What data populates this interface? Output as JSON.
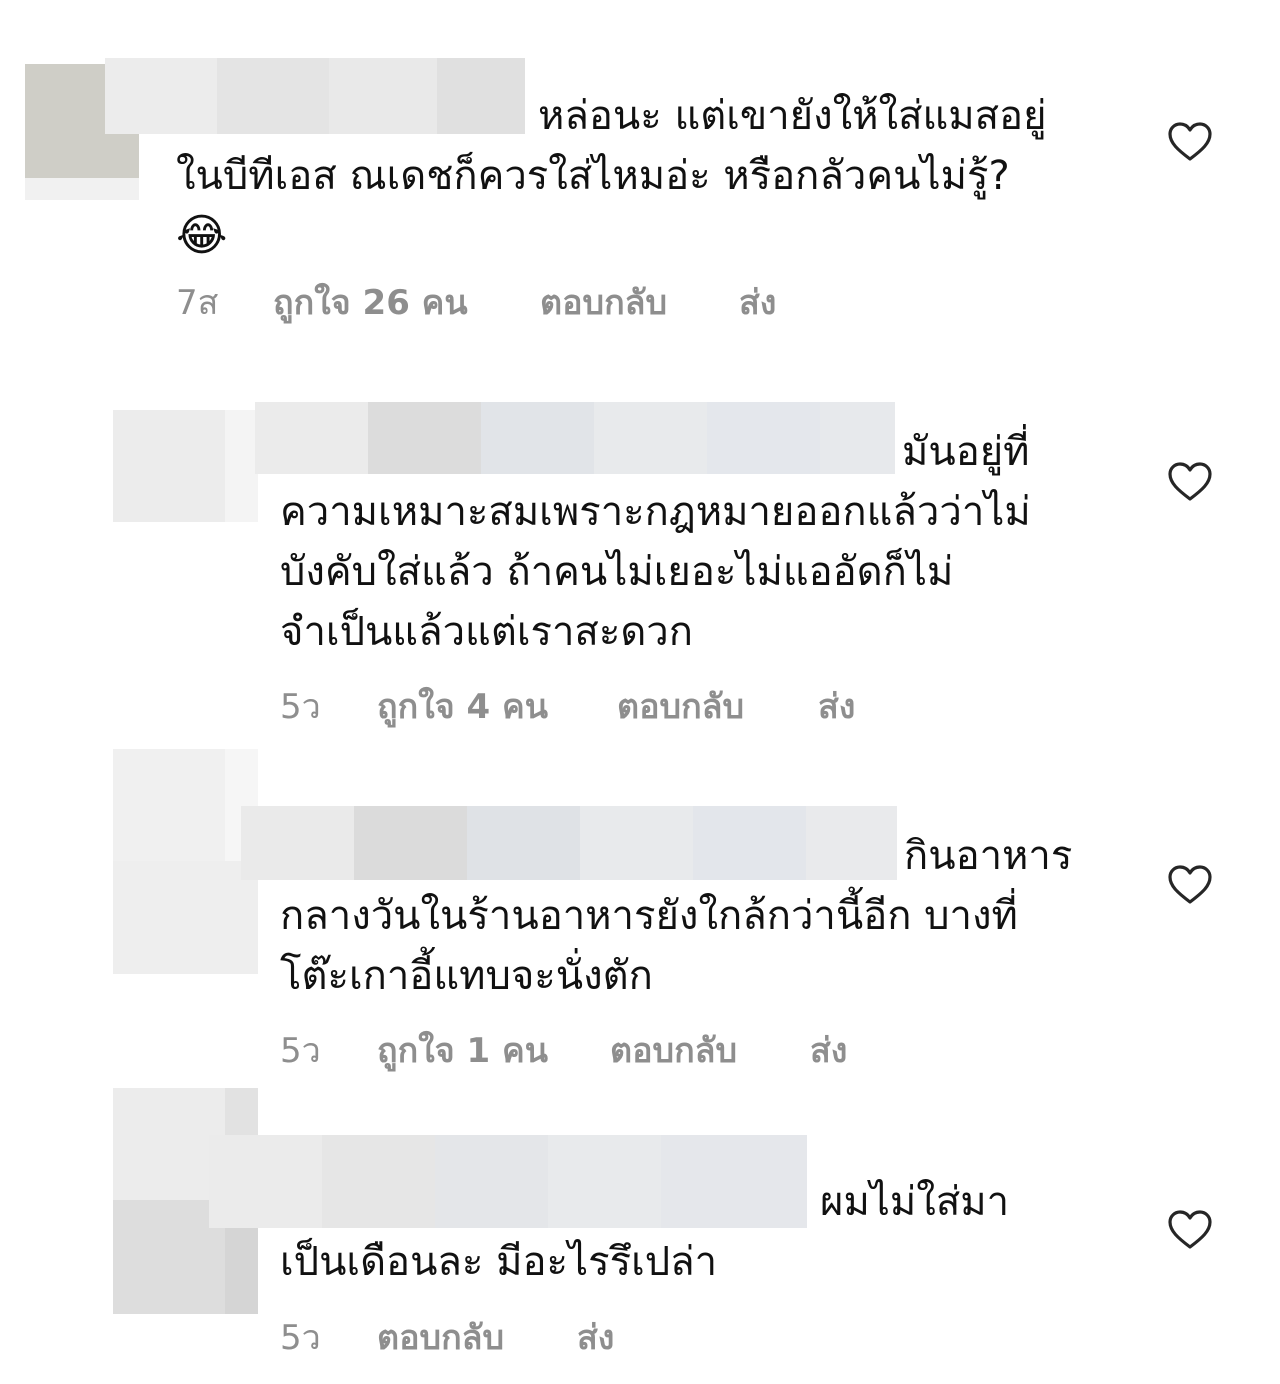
{
  "comments": [
    {
      "text_lines": [
        "หล่อนะ แต่เขายังให้ใส่แมสอยู่",
        "ในบีทีเอส ณเดชก็ควรใส่ไหมอ่ะ หรือกลัวคนไม่รู้?"
      ],
      "emoji": "😂",
      "time": "7ส",
      "likes": "ถูกใจ 26 คน",
      "reply": "ตอบกลับ",
      "send": "ส่ง"
    },
    {
      "text_lines": [
        "มันอยู่ที่",
        "ความเหมาะสมเพราะกฎหมายออกแล้วว่าไม่",
        "บังคับใส่แล้ว ถ้าคนไม่เยอะไม่แออัดก็ไม่",
        "จำเป็นแล้วแต่เราสะดวก"
      ],
      "time": "5ว",
      "likes": "ถูกใจ 4 คน",
      "reply": "ตอบกลับ",
      "send": "ส่ง"
    },
    {
      "text_lines": [
        "กินอาหาร",
        "กลางวันในร้านอาหารยังใกล้กว่านี้อีก บางที่",
        "โต๊ะเกาอี้แทบจะนั่งตัก"
      ],
      "time": "5ว",
      "likes": "ถูกใจ 1 คน",
      "reply": "ตอบกลับ",
      "send": "ส่ง"
    },
    {
      "text_lines": [
        "ผมไม่ใส่มา",
        "เป็นเดือนละ มีอะไรรึเปล่า"
      ],
      "time": "5ว",
      "reply": "ตอบกลับ",
      "send": "ส่ง"
    }
  ],
  "colors": {
    "text": "#111111",
    "meta": "#8e8e8e",
    "blur_light": "#e6e6e6",
    "blur_mid": "#dadada",
    "blur_blue": "#e1e5ea"
  },
  "icons": {
    "like": "heart-outline-icon"
  }
}
